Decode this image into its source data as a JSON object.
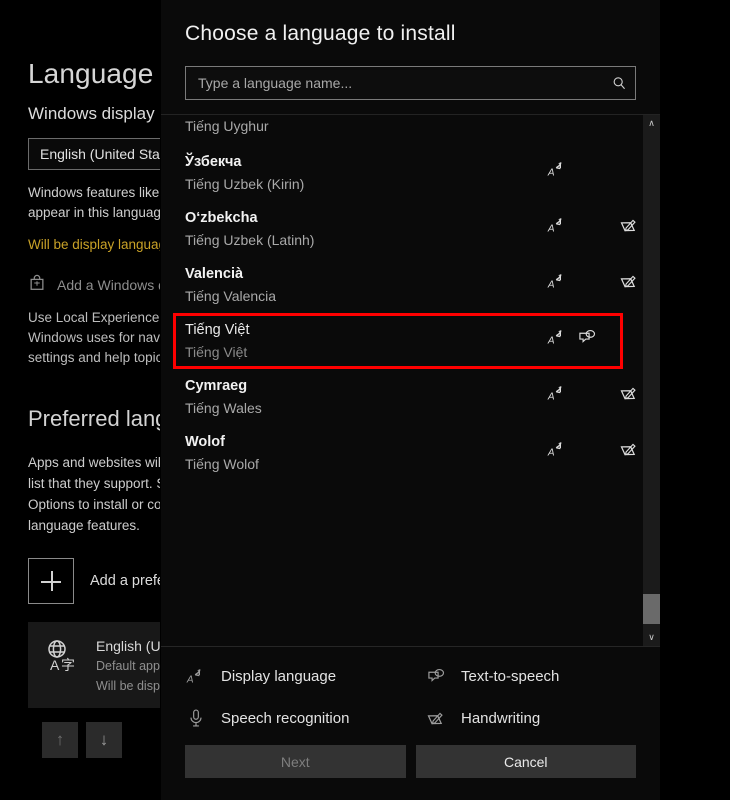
{
  "background_page": {
    "heading": "Language",
    "display_language_heading": "Windows display language",
    "display_language_value": "English (United States)",
    "display_language_desc": "Windows features like Settings and File Explorer will appear in this language.",
    "warning_text": "Will be display language after next sign-in",
    "store_link": "Add a Windows display language in Microsoft Store",
    "local_experience_desc": "Use Local Experience Packs to change the language Windows uses for navigation, menus, messages, settings and help topics.",
    "preferred_heading": "Preferred languages",
    "preferred_desc": "Apps and websites will appear in the first language in the list that they support. Select a language and then select Options to install or configure keyboards and other language features.",
    "add_preferred_label": "Add a preferred language",
    "language_card": {
      "title": "English (United States)",
      "line2": "Default app language",
      "line3": "Will be display language after next sign-in"
    },
    "move_up_label": "Move up",
    "move_down_label": "Move down",
    "icons": {
      "store": "store-bag-icon",
      "globe": "language-globe-icon",
      "up": "arrow-up-icon",
      "down": "arrow-down-icon",
      "plus": "plus-icon"
    }
  },
  "dialog": {
    "title": "Choose a language to install",
    "search": {
      "placeholder": "Type a language name...",
      "value": "",
      "icon": "search-icon"
    },
    "languages": [
      {
        "native": "",
        "localized": "Tiếng Uyghur",
        "partial": true,
        "selected": false,
        "features": []
      },
      {
        "native": "Ўзбекча",
        "localized": "Tiếng Uzbek (Kirin)",
        "partial": false,
        "selected": false,
        "features": [
          "display-language"
        ]
      },
      {
        "native": "O‘zbekcha",
        "localized": "Tiếng Uzbek (Latinh)",
        "partial": false,
        "selected": false,
        "features": [
          "display-language",
          "handwriting"
        ]
      },
      {
        "native": "Valencià",
        "localized": "Tiếng Valencia",
        "partial": false,
        "selected": false,
        "features": [
          "display-language",
          "handwriting"
        ]
      },
      {
        "native": "Tiếng Việt",
        "localized": "Tiếng Việt",
        "partial": false,
        "selected": true,
        "features": [
          "display-language",
          "text-to-speech"
        ]
      },
      {
        "native": "Cymraeg",
        "localized": "Tiếng Wales",
        "partial": false,
        "selected": false,
        "features": [
          "display-language",
          "handwriting"
        ]
      },
      {
        "native": "Wolof",
        "localized": "Tiếng Wolof",
        "partial": false,
        "selected": false,
        "features": [
          "display-language",
          "handwriting"
        ]
      }
    ],
    "legend": [
      {
        "icon": "display-language-icon",
        "label": "Display language"
      },
      {
        "icon": "text-to-speech-icon",
        "label": "Text-to-speech"
      },
      {
        "icon": "microphone-icon",
        "label": "Speech recognition"
      },
      {
        "icon": "handwriting-icon",
        "label": "Handwriting"
      }
    ],
    "buttons": {
      "next": "Next",
      "next_enabled": false,
      "cancel": "Cancel",
      "cancel_enabled": true
    },
    "scrollbar": {
      "up_glyph": "∧",
      "down_glyph": "∨"
    }
  },
  "annotation": {
    "highlight_color": "#ff0000",
    "target_row_index": 4
  }
}
